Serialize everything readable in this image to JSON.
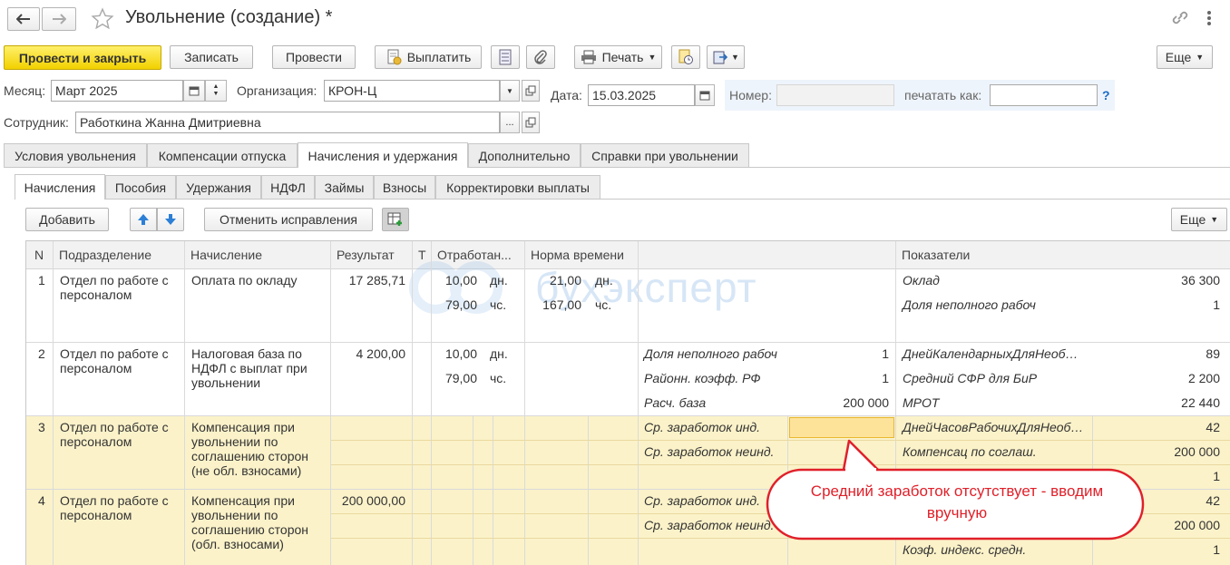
{
  "window": {
    "title": "Увольнение (создание) *"
  },
  "toolbar": {
    "post_close": "Провести и закрыть",
    "save": "Записать",
    "post": "Провести",
    "pay": "Выплатить",
    "print": "Печать",
    "more": "Еще"
  },
  "form": {
    "month_label": "Месяц:",
    "month_value": "Март 2025",
    "org_label": "Организация:",
    "org_value": "КРОН-Ц",
    "date_label": "Дата:",
    "date_value": "15.03.2025",
    "number_label": "Номер:",
    "number_value": "",
    "print_as_label": "печатать как:",
    "print_as_value": "",
    "help": "?",
    "employee_label": "Сотрудник:",
    "employee_value": "Работкина Жанна Дмитриевна",
    "ellipsis": "..."
  },
  "tabs": [
    {
      "label": "Условия увольнения"
    },
    {
      "label": "Компенсации отпуска"
    },
    {
      "label": "Начисления и удержания"
    },
    {
      "label": "Дополнительно"
    },
    {
      "label": "Справки при увольнении"
    }
  ],
  "subtabs": [
    {
      "label": "Начисления"
    },
    {
      "label": "Пособия"
    },
    {
      "label": "Удержания"
    },
    {
      "label": "НДФЛ"
    },
    {
      "label": "Займы"
    },
    {
      "label": "Взносы"
    },
    {
      "label": "Корректировки выплаты"
    }
  ],
  "grid_toolbar": {
    "add": "Добавить",
    "undo_corrections": "Отменить исправления",
    "more": "Еще"
  },
  "table": {
    "columns": [
      "N",
      "Подразделение",
      "Начисление",
      "Результат",
      "Т",
      "Отработан...",
      "Норма времени",
      "Показатели"
    ],
    "rows": [
      {
        "n": "1",
        "dept": "Отдел по работе с персоналом",
        "accrual": "Оплата по окладу",
        "result": "17 285,71",
        "worked": [
          [
            "10,00",
            "дн."
          ],
          [
            "79,00",
            "чс."
          ]
        ],
        "norm": [
          [
            "21,00",
            "дн."
          ],
          [
            "167,00",
            "чс."
          ]
        ],
        "mid": [],
        "indicators": [
          [
            "Оклад",
            "36 300"
          ],
          [
            "Доля неполного рабоч",
            "1"
          ]
        ]
      },
      {
        "n": "2",
        "dept": "Отдел по работе с персоналом",
        "accrual": "Налоговая база по НДФЛ с выплат при увольнении",
        "result": "4 200,00",
        "worked": [
          [
            "10,00",
            "дн."
          ],
          [
            "79,00",
            "чс."
          ]
        ],
        "norm": [],
        "mid": [
          [
            "Доля неполного рабоч",
            "1"
          ],
          [
            "Районн. коэфф. РФ",
            "1"
          ],
          [
            "Расч. база",
            "200 000"
          ]
        ],
        "indicators": [
          [
            "ДнейКалендарныхДляНеоб…",
            "89"
          ],
          [
            "Средний СФР для БиР",
            "2 200"
          ],
          [
            "МРОТ",
            "22 440"
          ]
        ]
      },
      {
        "n": "3",
        "dept": "Отдел по работе с персоналом",
        "accrual": "Компенсация при увольнении по соглашению сторон (не обл. взносами)",
        "result": "",
        "worked": [],
        "norm": [],
        "mid": [
          [
            "Ср. заработок инд.",
            ""
          ],
          [
            "Ср. заработок неинд.",
            ""
          ]
        ],
        "indicators": [
          [
            "ДнейЧасовРабочихДляНеоб…",
            "42"
          ],
          [
            "Компенсац по соглаш.",
            "200 000"
          ],
          [
            "",
            "1"
          ]
        ]
      },
      {
        "n": "4",
        "dept": "Отдел по работе с персоналом",
        "accrual": "Компенсация при увольнении по соглашению сторон (обл. взносами)",
        "result": "200 000,00",
        "worked": [],
        "norm": [],
        "mid": [
          [
            "Ср. заработок инд.",
            ""
          ],
          [
            "Ср. заработок неинд.",
            ""
          ]
        ],
        "indicators": [
          [
            "",
            "42"
          ],
          [
            "",
            "200 000"
          ],
          [
            "Коэф. индекс. средн.",
            "1"
          ]
        ]
      }
    ]
  },
  "watermark": "бухэксперт",
  "callout": "Средний заработок отсутствует - вводим вручную",
  "colors": {
    "primary_button": "#f5d60a",
    "selected_row": "#fbf2c9",
    "active_cell": "#fde39a",
    "callout_border": "#e0202a",
    "callout_text": "#e0202a"
  }
}
